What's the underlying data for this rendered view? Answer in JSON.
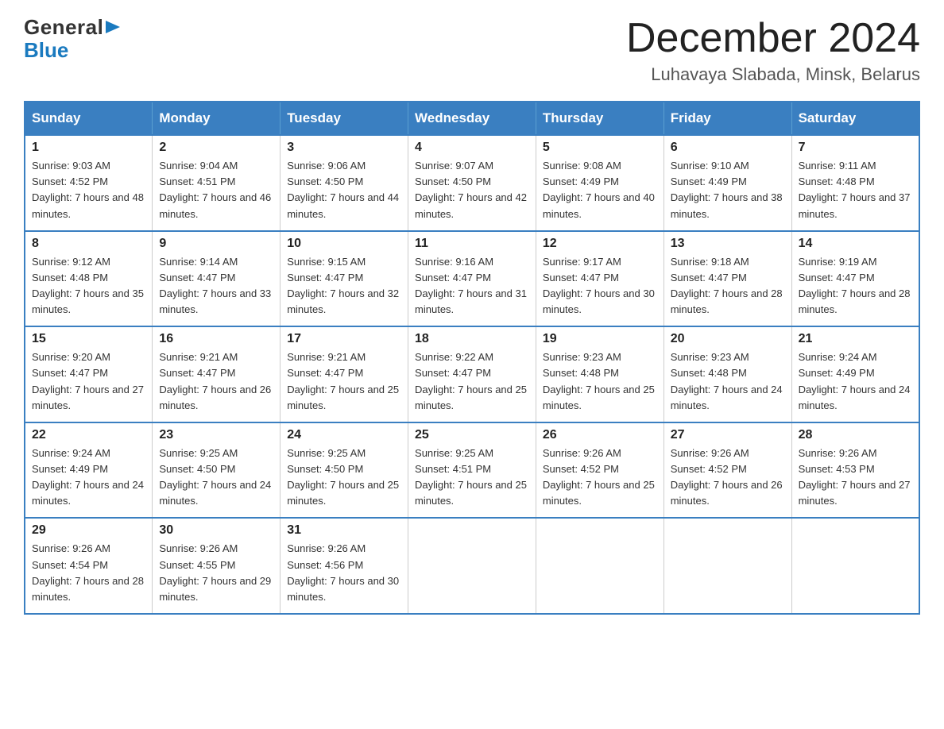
{
  "logo": {
    "line1": "General",
    "triangle": "▶",
    "line2": "Blue"
  },
  "title": "December 2024",
  "subtitle": "Luhavaya Slabada, Minsk, Belarus",
  "days_of_week": [
    "Sunday",
    "Monday",
    "Tuesday",
    "Wednesday",
    "Thursday",
    "Friday",
    "Saturday"
  ],
  "weeks": [
    [
      {
        "day": "1",
        "sunrise": "9:03 AM",
        "sunset": "4:52 PM",
        "daylight": "7 hours and 48 minutes."
      },
      {
        "day": "2",
        "sunrise": "9:04 AM",
        "sunset": "4:51 PM",
        "daylight": "7 hours and 46 minutes."
      },
      {
        "day": "3",
        "sunrise": "9:06 AM",
        "sunset": "4:50 PM",
        "daylight": "7 hours and 44 minutes."
      },
      {
        "day": "4",
        "sunrise": "9:07 AM",
        "sunset": "4:50 PM",
        "daylight": "7 hours and 42 minutes."
      },
      {
        "day": "5",
        "sunrise": "9:08 AM",
        "sunset": "4:49 PM",
        "daylight": "7 hours and 40 minutes."
      },
      {
        "day": "6",
        "sunrise": "9:10 AM",
        "sunset": "4:49 PM",
        "daylight": "7 hours and 38 minutes."
      },
      {
        "day": "7",
        "sunrise": "9:11 AM",
        "sunset": "4:48 PM",
        "daylight": "7 hours and 37 minutes."
      }
    ],
    [
      {
        "day": "8",
        "sunrise": "9:12 AM",
        "sunset": "4:48 PM",
        "daylight": "7 hours and 35 minutes."
      },
      {
        "day": "9",
        "sunrise": "9:14 AM",
        "sunset": "4:47 PM",
        "daylight": "7 hours and 33 minutes."
      },
      {
        "day": "10",
        "sunrise": "9:15 AM",
        "sunset": "4:47 PM",
        "daylight": "7 hours and 32 minutes."
      },
      {
        "day": "11",
        "sunrise": "9:16 AM",
        "sunset": "4:47 PM",
        "daylight": "7 hours and 31 minutes."
      },
      {
        "day": "12",
        "sunrise": "9:17 AM",
        "sunset": "4:47 PM",
        "daylight": "7 hours and 30 minutes."
      },
      {
        "day": "13",
        "sunrise": "9:18 AM",
        "sunset": "4:47 PM",
        "daylight": "7 hours and 28 minutes."
      },
      {
        "day": "14",
        "sunrise": "9:19 AM",
        "sunset": "4:47 PM",
        "daylight": "7 hours and 28 minutes."
      }
    ],
    [
      {
        "day": "15",
        "sunrise": "9:20 AM",
        "sunset": "4:47 PM",
        "daylight": "7 hours and 27 minutes."
      },
      {
        "day": "16",
        "sunrise": "9:21 AM",
        "sunset": "4:47 PM",
        "daylight": "7 hours and 26 minutes."
      },
      {
        "day": "17",
        "sunrise": "9:21 AM",
        "sunset": "4:47 PM",
        "daylight": "7 hours and 25 minutes."
      },
      {
        "day": "18",
        "sunrise": "9:22 AM",
        "sunset": "4:47 PM",
        "daylight": "7 hours and 25 minutes."
      },
      {
        "day": "19",
        "sunrise": "9:23 AM",
        "sunset": "4:48 PM",
        "daylight": "7 hours and 25 minutes."
      },
      {
        "day": "20",
        "sunrise": "9:23 AM",
        "sunset": "4:48 PM",
        "daylight": "7 hours and 24 minutes."
      },
      {
        "day": "21",
        "sunrise": "9:24 AM",
        "sunset": "4:49 PM",
        "daylight": "7 hours and 24 minutes."
      }
    ],
    [
      {
        "day": "22",
        "sunrise": "9:24 AM",
        "sunset": "4:49 PM",
        "daylight": "7 hours and 24 minutes."
      },
      {
        "day": "23",
        "sunrise": "9:25 AM",
        "sunset": "4:50 PM",
        "daylight": "7 hours and 24 minutes."
      },
      {
        "day": "24",
        "sunrise": "9:25 AM",
        "sunset": "4:50 PM",
        "daylight": "7 hours and 25 minutes."
      },
      {
        "day": "25",
        "sunrise": "9:25 AM",
        "sunset": "4:51 PM",
        "daylight": "7 hours and 25 minutes."
      },
      {
        "day": "26",
        "sunrise": "9:26 AM",
        "sunset": "4:52 PM",
        "daylight": "7 hours and 25 minutes."
      },
      {
        "day": "27",
        "sunrise": "9:26 AM",
        "sunset": "4:52 PM",
        "daylight": "7 hours and 26 minutes."
      },
      {
        "day": "28",
        "sunrise": "9:26 AM",
        "sunset": "4:53 PM",
        "daylight": "7 hours and 27 minutes."
      }
    ],
    [
      {
        "day": "29",
        "sunrise": "9:26 AM",
        "sunset": "4:54 PM",
        "daylight": "7 hours and 28 minutes."
      },
      {
        "day": "30",
        "sunrise": "9:26 AM",
        "sunset": "4:55 PM",
        "daylight": "7 hours and 29 minutes."
      },
      {
        "day": "31",
        "sunrise": "9:26 AM",
        "sunset": "4:56 PM",
        "daylight": "7 hours and 30 minutes."
      },
      null,
      null,
      null,
      null
    ]
  ]
}
